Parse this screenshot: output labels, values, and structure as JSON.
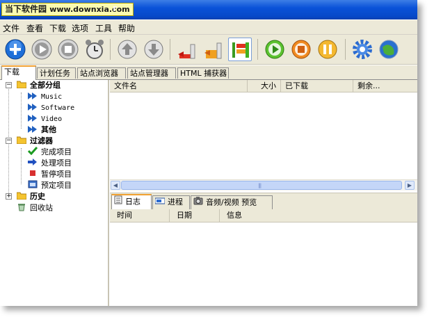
{
  "watermark": {
    "brand": "当下软件园",
    "url": "www.downxia.com"
  },
  "title_rest": "r",
  "menu": [
    "文件",
    "查看",
    "下载",
    "选项",
    "工具",
    "帮助"
  ],
  "toolbar": [
    {
      "name": "add-icon"
    },
    {
      "name": "play-icon"
    },
    {
      "name": "stop-icon"
    },
    {
      "name": "alarm-clock-icon"
    },
    {
      "name": "move-up-icon"
    },
    {
      "name": "move-down-icon"
    },
    {
      "name": "speed-low-icon"
    },
    {
      "name": "speed-medium-icon"
    },
    {
      "name": "speed-high-icon"
    },
    {
      "name": "start-all-icon"
    },
    {
      "name": "stop-all-icon"
    },
    {
      "name": "pause-all-icon"
    },
    {
      "name": "settings-gear-icon"
    },
    {
      "name": "globe-icon"
    }
  ],
  "tabs": [
    "下载",
    "计划任务",
    "站点浏览器",
    "站点管理器",
    "HTML 捕获器"
  ],
  "tree": {
    "all_groups": "全部分组",
    "groups": [
      "Music",
      "Software",
      "Video",
      "其他"
    ],
    "filters": "过滤器",
    "filter_items": [
      "完成项目",
      "处理项目",
      "暂停项目",
      "预定项目"
    ],
    "history": "历史",
    "recycle": "回收站"
  },
  "list_columns": [
    "文件名",
    "大小",
    "已下载",
    "剩余..."
  ],
  "bottom_tabs": [
    "日志",
    "进程",
    "音频/视频 预览"
  ],
  "log_columns": [
    "时间",
    "日期",
    "信息"
  ],
  "colors": {
    "titlebar": "#0a52d8",
    "accent_tab": "#f0a030",
    "chrome": "#ece9d8"
  }
}
